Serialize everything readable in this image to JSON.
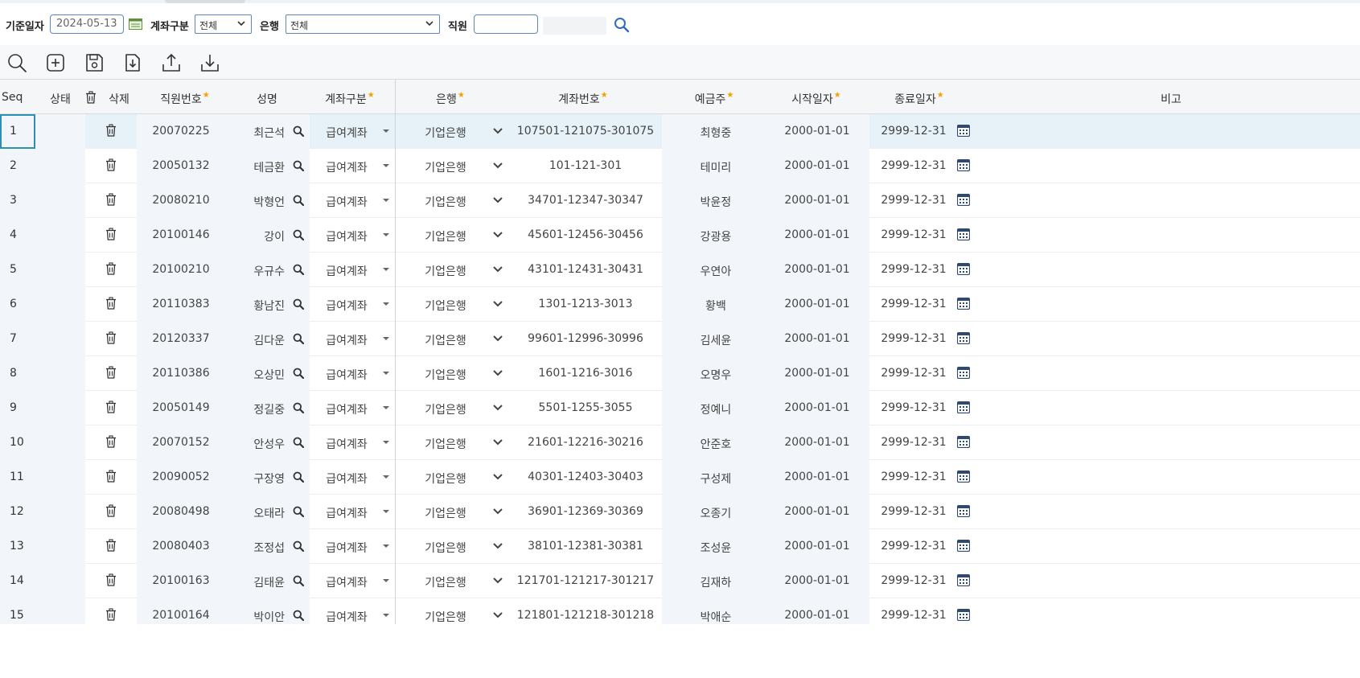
{
  "filters": {
    "base_date_label": "기준일자",
    "base_date_value": "2024-05-13",
    "account_type_label": "계좌구분",
    "account_type_value": "전체",
    "bank_label": "은행",
    "bank_value": "전체",
    "employee_label": "직원",
    "employee_value": ""
  },
  "toolbar": {
    "icons": [
      "search-icon",
      "add-icon",
      "save-icon",
      "import-icon",
      "upload-icon",
      "download-icon"
    ]
  },
  "grid": {
    "headers": {
      "seq": "Seq",
      "status": "상태",
      "delete": "삭제",
      "emp_no": "직원번호",
      "name": "성명",
      "acct_type": "계좌구분",
      "bank": "은행",
      "acct_no": "계좌번호",
      "holder": "예금주",
      "start": "시작일자",
      "end": "종료일자",
      "note": "비고"
    },
    "required_mark": "★",
    "selected_row": 0,
    "rows": [
      {
        "seq": "1",
        "emp_no": "20070225",
        "name": "최근석",
        "acct_type": "급여계좌",
        "bank": "기업은행",
        "acct_no": "107501-121075-301075",
        "holder": "최형중",
        "start": "2000-01-01",
        "end": "2999-12-31"
      },
      {
        "seq": "2",
        "emp_no": "20050132",
        "name": "테금환",
        "acct_type": "급여계좌",
        "bank": "기업은행",
        "acct_no": "101-121-301",
        "holder": "테미리",
        "start": "2000-01-01",
        "end": "2999-12-31"
      },
      {
        "seq": "3",
        "emp_no": "20080210",
        "name": "박형언",
        "acct_type": "급여계좌",
        "bank": "기업은행",
        "acct_no": "34701-12347-30347",
        "holder": "박윤정",
        "start": "2000-01-01",
        "end": "2999-12-31"
      },
      {
        "seq": "4",
        "emp_no": "20100146",
        "name": "강이",
        "acct_type": "급여계좌",
        "bank": "기업은행",
        "acct_no": "45601-12456-30456",
        "holder": "강광용",
        "start": "2000-01-01",
        "end": "2999-12-31"
      },
      {
        "seq": "5",
        "emp_no": "20100210",
        "name": "우규수",
        "acct_type": "급여계좌",
        "bank": "기업은행",
        "acct_no": "43101-12431-30431",
        "holder": "우연아",
        "start": "2000-01-01",
        "end": "2999-12-31"
      },
      {
        "seq": "6",
        "emp_no": "20110383",
        "name": "황남진",
        "acct_type": "급여계좌",
        "bank": "기업은행",
        "acct_no": "1301-1213-3013",
        "holder": "황백",
        "start": "2000-01-01",
        "end": "2999-12-31"
      },
      {
        "seq": "7",
        "emp_no": "20120337",
        "name": "김다운",
        "acct_type": "급여계좌",
        "bank": "기업은행",
        "acct_no": "99601-12996-30996",
        "holder": "김세윤",
        "start": "2000-01-01",
        "end": "2999-12-31"
      },
      {
        "seq": "8",
        "emp_no": "20110386",
        "name": "오상민",
        "acct_type": "급여계좌",
        "bank": "기업은행",
        "acct_no": "1601-1216-3016",
        "holder": "오명우",
        "start": "2000-01-01",
        "end": "2999-12-31"
      },
      {
        "seq": "9",
        "emp_no": "20050149",
        "name": "정길중",
        "acct_type": "급여계좌",
        "bank": "기업은행",
        "acct_no": "5501-1255-3055",
        "holder": "정예니",
        "start": "2000-01-01",
        "end": "2999-12-31"
      },
      {
        "seq": "10",
        "emp_no": "20070152",
        "name": "안성우",
        "acct_type": "급여계좌",
        "bank": "기업은행",
        "acct_no": "21601-12216-30216",
        "holder": "안준호",
        "start": "2000-01-01",
        "end": "2999-12-31"
      },
      {
        "seq": "11",
        "emp_no": "20090052",
        "name": "구장영",
        "acct_type": "급여계좌",
        "bank": "기업은행",
        "acct_no": "40301-12403-30403",
        "holder": "구성제",
        "start": "2000-01-01",
        "end": "2999-12-31"
      },
      {
        "seq": "12",
        "emp_no": "20080498",
        "name": "오태라",
        "acct_type": "급여계좌",
        "bank": "기업은행",
        "acct_no": "36901-12369-30369",
        "holder": "오종기",
        "start": "2000-01-01",
        "end": "2999-12-31"
      },
      {
        "seq": "13",
        "emp_no": "20080403",
        "name": "조정섭",
        "acct_type": "급여계좌",
        "bank": "기업은행",
        "acct_no": "38101-12381-30381",
        "holder": "조성윤",
        "start": "2000-01-01",
        "end": "2999-12-31"
      },
      {
        "seq": "14",
        "emp_no": "20100163",
        "name": "김태윤",
        "acct_type": "급여계좌",
        "bank": "기업은행",
        "acct_no": "121701-121217-301217",
        "holder": "김재하",
        "start": "2000-01-01",
        "end": "2999-12-31"
      },
      {
        "seq": "15",
        "emp_no": "20100164",
        "name": "박이안",
        "acct_type": "급여계좌",
        "bank": "기업은행",
        "acct_no": "121801-121218-301218",
        "holder": "박애순",
        "start": "2000-01-01",
        "end": "2999-12-31"
      }
    ]
  },
  "colors": {
    "accent": "#5a86c2",
    "selected_row": "#e6f2f8",
    "selected_border": "#2e8fb4",
    "required_star": "#f5a000",
    "readonly_column": "#f2f5f9"
  }
}
